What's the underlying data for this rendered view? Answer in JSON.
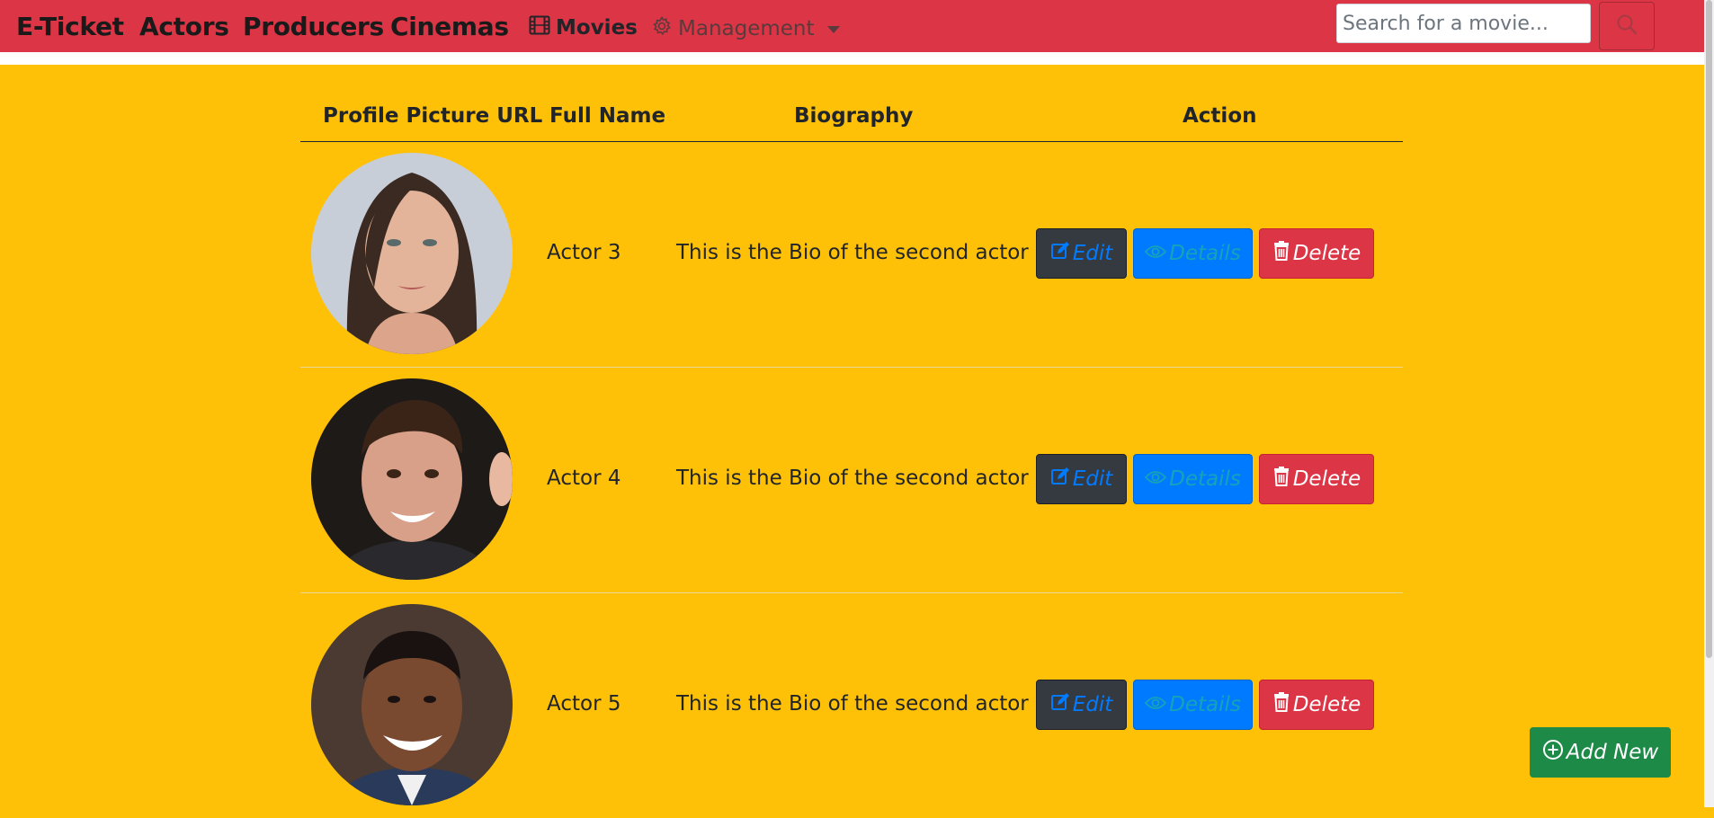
{
  "navbar": {
    "brand": "E-Ticket",
    "links": [
      "Actors",
      "Producers",
      "Cinemas"
    ],
    "movies_label": "Movies",
    "management_label": "Management",
    "search": {
      "placeholder": "Search for a movie..."
    }
  },
  "table": {
    "headers": [
      "Profile Picture URL",
      "Full Name",
      "Biography",
      "Action"
    ],
    "rows": [
      {
        "name": "Actor 3",
        "bio": "This is the Bio of the second actor"
      },
      {
        "name": "Actor 4",
        "bio": "This is the Bio of the second actor"
      },
      {
        "name": "Actor 5",
        "bio": "This is the Bio of the second actor"
      }
    ],
    "actions": {
      "edit": "Edit",
      "details": "Details",
      "delete": "Delete"
    }
  },
  "add_new_label": "Add New",
  "colors": {
    "navbar": "#dc3545",
    "background": "#ffc107",
    "edit_button": "#343a40",
    "details_button": "#007bff",
    "delete_button": "#dc3545",
    "add_button": "#28a745"
  }
}
